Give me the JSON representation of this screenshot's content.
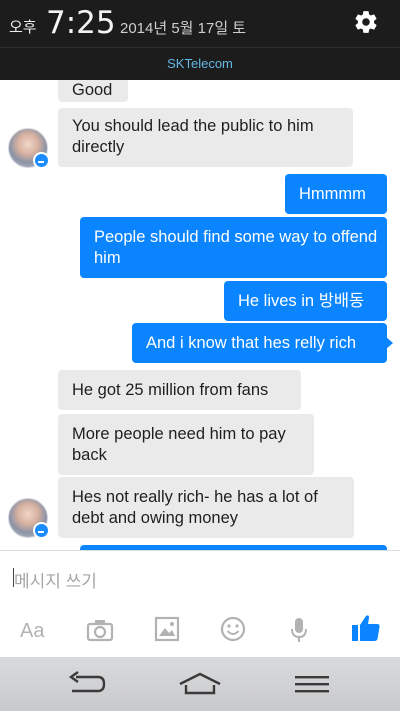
{
  "status_bar": {
    "ampm": "오후",
    "time": "7:25",
    "date": "2014년 5월 17일 토"
  },
  "carrier": "SKTelecom",
  "messages": [
    {
      "side": "in",
      "text": "Good"
    },
    {
      "side": "in",
      "text": "You should lead the public to him directly"
    },
    {
      "side": "out",
      "text": "Hmmmm"
    },
    {
      "side": "out",
      "text": "People should find some way to offend him"
    },
    {
      "side": "out",
      "text": "He lives in 방배동"
    },
    {
      "side": "out",
      "text": "And i know that hes relly rich"
    },
    {
      "side": "in",
      "text": "He got 25 million from fans"
    },
    {
      "side": "in",
      "text": "More people need him to pay back"
    },
    {
      "side": "in",
      "text": "Hes not really rich- he has a lot of debt and owing money"
    }
  ],
  "composer": {
    "placeholder": "메시지 쓰기"
  },
  "toolbar": {
    "text_format_label": "Aa"
  },
  "colors": {
    "accent": "#0a84ff",
    "incoming_bubble": "#eaeaea",
    "status_bar": "#1c1c1c",
    "carrier_text": "#63b8e6"
  },
  "icons": [
    "gear-icon",
    "camera-icon",
    "gallery-icon",
    "emoji-icon",
    "microphone-icon",
    "thumbs-up-icon",
    "back-icon",
    "home-icon",
    "menu-icon"
  ]
}
